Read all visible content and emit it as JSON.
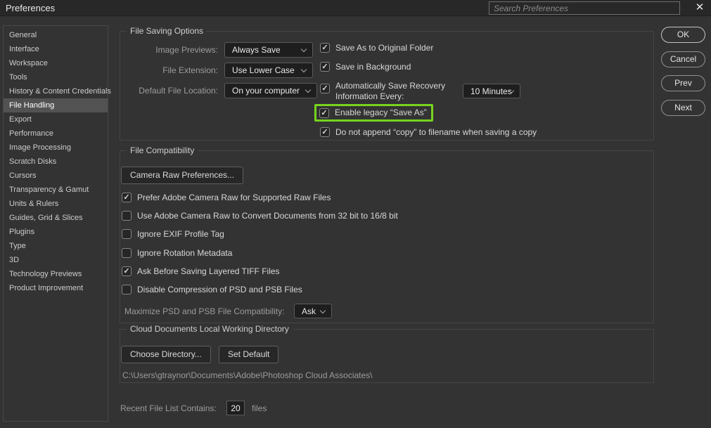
{
  "titlebar": {
    "title": "Preferences",
    "search_placeholder": "Search Preferences",
    "close_glyph": "✕"
  },
  "sidebar": {
    "items": [
      {
        "label": "General",
        "selected": false
      },
      {
        "label": "Interface",
        "selected": false
      },
      {
        "label": "Workspace",
        "selected": false
      },
      {
        "label": "Tools",
        "selected": false
      },
      {
        "label": "History & Content Credentials",
        "selected": false
      },
      {
        "label": "File Handling",
        "selected": true
      },
      {
        "label": "Export",
        "selected": false
      },
      {
        "label": "Performance",
        "selected": false
      },
      {
        "label": "Image Processing",
        "selected": false
      },
      {
        "label": "Scratch Disks",
        "selected": false
      },
      {
        "label": "Cursors",
        "selected": false
      },
      {
        "label": "Transparency & Gamut",
        "selected": false
      },
      {
        "label": "Units & Rulers",
        "selected": false
      },
      {
        "label": "Guides, Grid & Slices",
        "selected": false
      },
      {
        "label": "Plugins",
        "selected": false
      },
      {
        "label": "Type",
        "selected": false
      },
      {
        "label": "3D",
        "selected": false
      },
      {
        "label": "Technology Previews",
        "selected": false
      },
      {
        "label": "Product Improvement",
        "selected": false
      }
    ]
  },
  "actions": {
    "ok": "OK",
    "cancel": "Cancel",
    "prev": "Prev",
    "next": "Next"
  },
  "file_saving": {
    "title": "File Saving Options",
    "image_previews_label": "Image Previews:",
    "image_previews_value": "Always Save",
    "file_extension_label": "File Extension:",
    "file_extension_value": "Use Lower Case",
    "default_location_label": "Default File Location:",
    "default_location_value": "On your computer",
    "checkboxes": [
      {
        "label": "Save As to Original Folder",
        "check": "✓"
      },
      {
        "label": "Save in Background",
        "check": "✓"
      },
      {
        "label": "Automatically Save Recovery Information Every:",
        "check": "✓"
      },
      {
        "label": "Enable legacy “Save As”",
        "check": "✓"
      },
      {
        "label": "Do not append “copy” to filename when saving a copy",
        "check": "✓"
      }
    ],
    "auto_save_interval": "10 Minutes"
  },
  "file_compat": {
    "title": "File Compatibility",
    "camera_raw_button": "Camera Raw Preferences...",
    "checkboxes": [
      {
        "label": "Prefer Adobe Camera Raw for Supported Raw Files",
        "check": "✓"
      },
      {
        "label": "Use Adobe Camera Raw to Convert Documents from 32 bit to 16/8 bit",
        "check": ""
      },
      {
        "label": "Ignore EXIF Profile Tag",
        "check": ""
      },
      {
        "label": "Ignore Rotation Metadata",
        "check": ""
      },
      {
        "label": "Ask Before Saving Layered TIFF Files",
        "check": "✓"
      },
      {
        "label": "Disable Compression of PSD and PSB Files",
        "check": ""
      }
    ],
    "maximize_label": "Maximize PSD and PSB File Compatibility:",
    "maximize_value": "Ask"
  },
  "cloud_docs": {
    "title": "Cloud Documents Local Working Directory",
    "choose_directory_button": "Choose Directory...",
    "set_default_button": "Set Default",
    "path": "C:\\Users\\gtraynor\\Documents\\Adobe\\Photoshop Cloud Associates\\"
  },
  "recent": {
    "label": "Recent File List Contains:",
    "value": "20",
    "suffix": "files"
  },
  "colors": {
    "highlight_green": "#76d41e",
    "dialog_bg": "#333333",
    "titlebar_bg": "#282828",
    "control_bg": "#1e1e1e",
    "selected_item_bg": "#525252"
  }
}
